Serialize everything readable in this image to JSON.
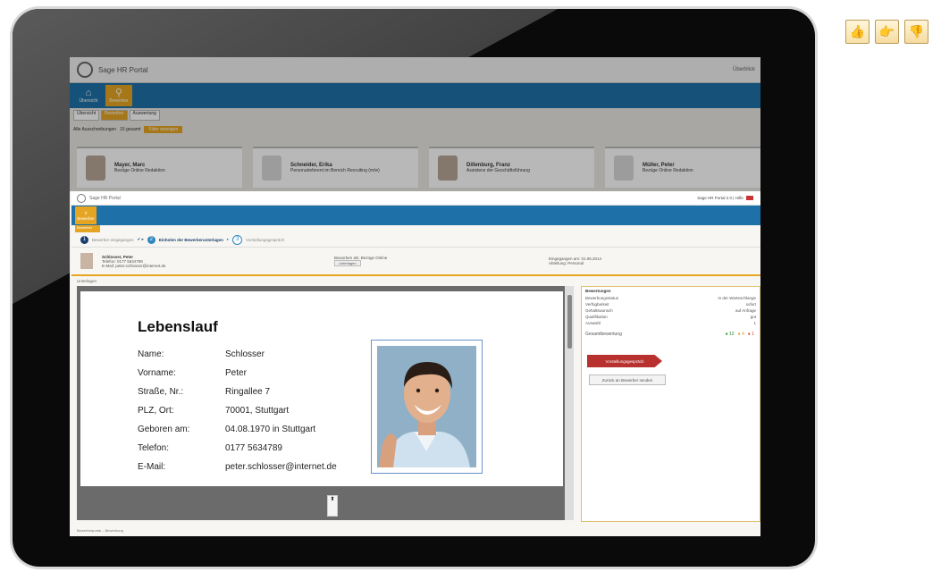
{
  "background_app": {
    "window_title": "Sage HR Portal",
    "top_right": "Überblick",
    "nav": [
      {
        "icon": "home-icon",
        "label": "Übersicht"
      },
      {
        "icon": "search-icon",
        "label": "Bewerber"
      }
    ],
    "tabs": [
      "Übersicht",
      "Bewerber",
      "Auswertung"
    ],
    "filter": {
      "select": "Alle Ausschreibungen",
      "count": "15 gesamt",
      "btn": "Filter anzeigen"
    },
    "cards": [
      {
        "name": "Mayer, Marc",
        "role": "Bezüge Online Redaktion"
      },
      {
        "name": "Schneider, Erika",
        "role": "Personalreferent im Bereich Recruiting (m/w)"
      },
      {
        "name": "Dillenburg, Franz",
        "role": "Assistenz der Geschäftsführung"
      },
      {
        "name": "Müller, Peter",
        "role": "Bezüge Online Redaktion"
      }
    ]
  },
  "foreground": {
    "window_title": "Sage HR Portal",
    "top_right": "Sage HR Portal 2.0 | Hilfe",
    "nav_label": "Bewerber",
    "sub_tab": "Bewerber",
    "steps": [
      {
        "num": "1",
        "label": "Bewerber eingegangen"
      },
      {
        "num": "2",
        "label": "Einholen der Bewerberunterlagen"
      },
      {
        "num": "3",
        "label": "Vorstellungsgespräch"
      }
    ],
    "applicant": {
      "name": "Schlosser, Peter",
      "contact_line": "Telefon: 0177 5634789",
      "email_line": "E-Mail: peter.schlosser@internet.de",
      "col2": "Beworben als: Bezüge Online",
      "btn": "Unterlagen",
      "col3": "Eingegangen am: 01.06.2014",
      "col3b": "Abteilung: Personal"
    },
    "doc_label": "Unterlagen",
    "status_bar": "Bewerberportal – Bewerbung"
  },
  "cv": {
    "title": "Lebenslauf",
    "rows": [
      {
        "key": "Name:",
        "value": "Schlosser"
      },
      {
        "key": "Vorname:",
        "value": "Peter"
      },
      {
        "key": "Straße, Nr.:",
        "value": "Ringallee 7"
      },
      {
        "key": "PLZ, Ort:",
        "value": "70001, Stuttgart"
      },
      {
        "key": "Geboren am:",
        "value": "04.08.1970 in Stuttgart"
      },
      {
        "key": "Telefon:",
        "value": "0177 5634789"
      },
      {
        "key": "E-Mail:",
        "value": "peter.schlosser@internet.de"
      }
    ]
  },
  "side_panel": {
    "heading": "Bewertungen",
    "lines": [
      {
        "k": "Bewerbungsstatus",
        "v": "In der Warteschlange"
      },
      {
        "k": "Verfügbarkeit",
        "v": "sofort"
      },
      {
        "k": "Gehaltswunsch",
        "v": "auf Anfrage"
      },
      {
        "k": "Qualifikation",
        "v": "gut"
      },
      {
        "k": "Auswahl",
        "v": "1"
      }
    ],
    "rating_label": "Gesamtbewertung",
    "ratings": {
      "green": "12",
      "orange": "4",
      "red": "1"
    },
    "ribbon": "Vorstellungsgespräch",
    "action_btn": "Zurück an Bewerber senden"
  },
  "rating_icons": [
    {
      "name": "thumbs-up-icon",
      "glyph": "👍"
    },
    {
      "name": "pointing-hand-icon",
      "glyph": "👉"
    },
    {
      "name": "thumbs-down-icon",
      "glyph": "👎"
    }
  ]
}
